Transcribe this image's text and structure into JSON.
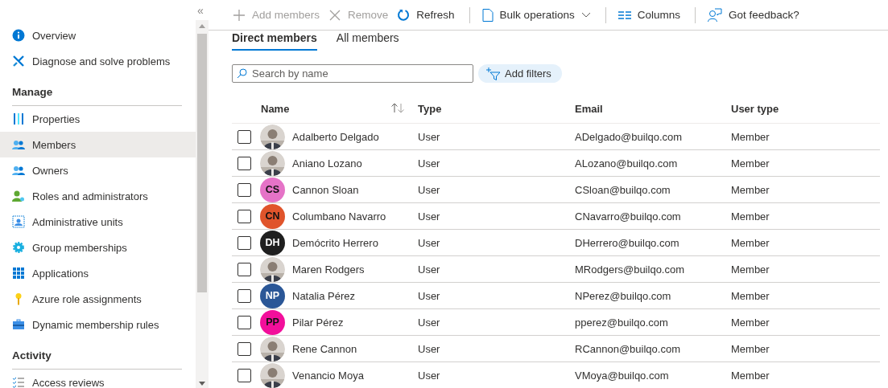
{
  "sidebar": {
    "collapse_glyph": "«",
    "groups": [
      {
        "items": [
          {
            "label": "Overview",
            "selected": false
          },
          {
            "label": "Diagnose and solve problems",
            "selected": false
          }
        ]
      },
      {
        "title": "Manage",
        "items": [
          {
            "label": "Properties",
            "selected": false
          },
          {
            "label": "Members",
            "selected": true
          },
          {
            "label": "Owners",
            "selected": false
          },
          {
            "label": "Roles and administrators",
            "selected": false
          },
          {
            "label": "Administrative units",
            "selected": false
          },
          {
            "label": "Group memberships",
            "selected": false
          },
          {
            "label": "Applications",
            "selected": false
          },
          {
            "label": "Azure role assignments",
            "selected": false
          },
          {
            "label": "Dynamic membership rules",
            "selected": false
          }
        ]
      },
      {
        "title": "Activity",
        "items": [
          {
            "label": "Access reviews",
            "selected": false
          }
        ]
      }
    ]
  },
  "toolbar": [
    {
      "label": "Add members",
      "disabled": true
    },
    {
      "label": "Remove",
      "disabled": true
    },
    {
      "label": "Refresh",
      "disabled": false
    },
    {
      "label": "Bulk operations",
      "disabled": false
    },
    {
      "label": "Columns",
      "disabled": false
    },
    {
      "label": "Got feedback?",
      "disabled": false
    }
  ],
  "tabs": [
    {
      "label": "Direct members",
      "selected": true
    },
    {
      "label": "All members",
      "selected": false
    }
  ],
  "search": {
    "placeholder": "Search by name"
  },
  "filter_button": "Add filters",
  "table": {
    "columns": [
      "Name",
      "Type",
      "Email",
      "User type"
    ],
    "rows": [
      {
        "checked": false,
        "name": "Adalberto Delgado",
        "type": "User",
        "email": "ADelgado@builqo.com",
        "user_type": "Member"
      },
      {
        "checked": false,
        "name": "Aniano Lozano",
        "type": "User",
        "email": "ALozano@builqo.com",
        "user_type": "Member"
      },
      {
        "checked": false,
        "avatar": {
          "kind": "initials",
          "initials": "CS",
          "color": "#e573c7"
        },
        "name": "Cannon Sloan",
        "type": "User",
        "email": "CSloan@builqo.com",
        "user_type": "Member"
      },
      {
        "checked": false,
        "avatar": {
          "kind": "initials",
          "initials": "CN",
          "color": "#e0542b"
        },
        "name": "Columbano Navarro",
        "type": "User",
        "email": "CNavarro@builqo.com",
        "user_type": "Member"
      },
      {
        "checked": false,
        "avatar": {
          "kind": "initials",
          "initials": "DH",
          "color": "#1f1f1f"
        },
        "name": "Demócrito Herrero",
        "type": "User",
        "email": "DHerrero@builqo.com",
        "user_type": "Member"
      },
      {
        "checked": false,
        "name": "Maren Rodgers",
        "type": "User",
        "email": "MRodgers@builqo.com",
        "user_type": "Member"
      },
      {
        "checked": false,
        "avatar": {
          "kind": "initials",
          "initials": "NP",
          "color": "#2b5797"
        },
        "name": "Natalia Pérez",
        "type": "User",
        "email": "NPerez@builqo.com",
        "user_type": "Member"
      },
      {
        "checked": false,
        "avatar": {
          "kind": "initials",
          "initials": "PP",
          "color": "#f20f9b"
        },
        "name": "Pilar Pérez",
        "type": "User",
        "email": "pperez@builqo.com",
        "user_type": "Member"
      },
      {
        "checked": false,
        "name": "Rene Cannon",
        "type": "User",
        "email": "RCannon@builqo.com",
        "user_type": "Member"
      },
      {
        "checked": false,
        "name": "Venancio Moya",
        "type": "User",
        "email": "VMoya@builqo.com",
        "user_type": "Member"
      }
    ]
  }
}
